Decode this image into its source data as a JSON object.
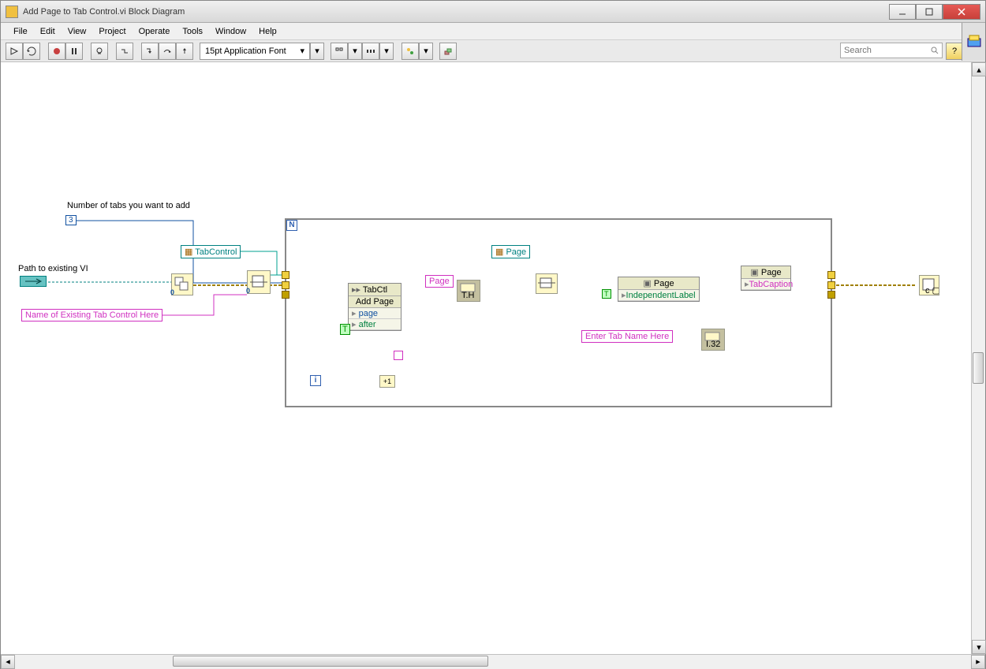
{
  "window": {
    "title": "Add Page to Tab Control.vi Block Diagram"
  },
  "menu": {
    "items": [
      "File",
      "Edit",
      "View",
      "Project",
      "Operate",
      "Tools",
      "Window",
      "Help"
    ]
  },
  "toolbar": {
    "font": "15pt Application Font",
    "search_placeholder": "Search",
    "help_symbol": "?"
  },
  "diagram": {
    "labels": {
      "num_tabs": "Number of tabs you want to add",
      "num_tabs_value": "3",
      "path_lbl": "Path to existing VI",
      "tab_ctrl_ref": "TabControl",
      "existing_name": "Name of Existing Tab Control Here",
      "page_ref": "Page",
      "page_lbl": "Page",
      "enter_tab": "Enter Tab Name Here",
      "for_N": "N",
      "for_i": "i",
      "true_const": "T"
    },
    "invoke": {
      "header": "TabCtl",
      "method": "Add Page",
      "rows": [
        "page",
        "after"
      ]
    },
    "prop1": {
      "header": "Page",
      "rows": [
        "IndependentLabel"
      ]
    },
    "prop2": {
      "header": "Page",
      "rows": [
        "TabCaption"
      ]
    }
  }
}
